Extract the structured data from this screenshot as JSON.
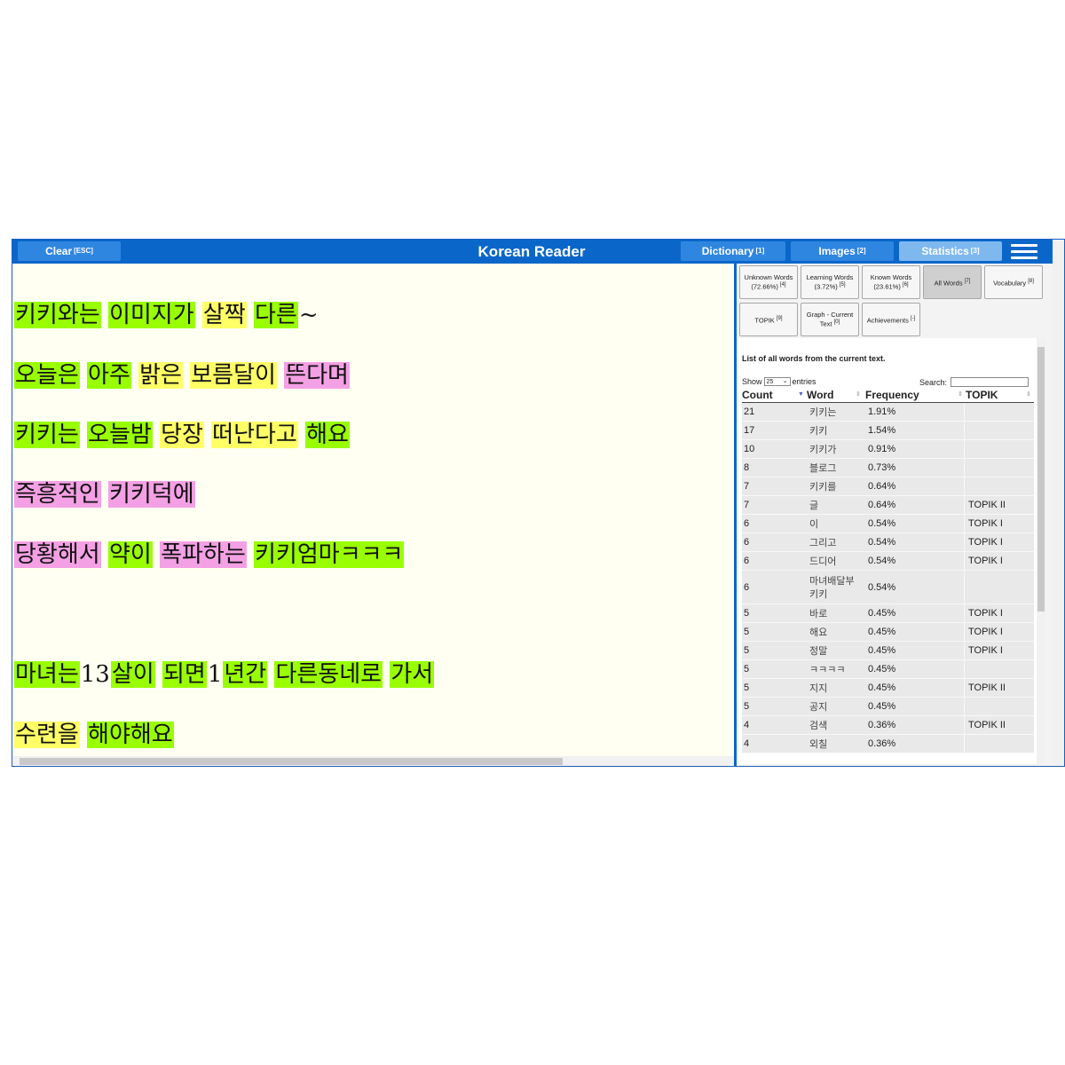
{
  "header": {
    "clear_label": "Clear",
    "clear_key": "[ESC]",
    "title": "Korean Reader",
    "dictionary_label": "Dictionary",
    "dictionary_key": "[1]",
    "images_label": "Images",
    "images_key": "[2]",
    "statistics_label": "Statistics",
    "statistics_key": "[3]",
    "menu_icon": "hamburger-menu-icon"
  },
  "colors": {
    "known": "#99ff00",
    "learning": "#ffff66",
    "unknown": "#f4a0e4",
    "header": "#0a67c9",
    "reader_bg": "#fffff2"
  },
  "reader": {
    "lines": [
      {
        "words": [
          {
            "text": "키키와는",
            "status": "g"
          },
          {
            "text": "이미지가",
            "status": "g"
          },
          {
            "text": "살짝",
            "status": "y"
          },
          {
            "text": "다른",
            "status": "g"
          },
          {
            "text": "~",
            "status": "n"
          }
        ]
      },
      {
        "words": [
          {
            "text": "오늘은",
            "status": "g"
          },
          {
            "text": "아주",
            "status": "g"
          },
          {
            "text": "밝은",
            "status": "y"
          },
          {
            "text": "보름달이",
            "status": "y"
          },
          {
            "text": "뜬다며",
            "status": "p"
          }
        ]
      },
      {
        "words": [
          {
            "text": "키키는",
            "status": "g"
          },
          {
            "text": "오늘밤",
            "status": "g"
          },
          {
            "text": "당장",
            "status": "y"
          },
          {
            "text": "떠난다고",
            "status": "y"
          },
          {
            "text": "해요",
            "status": "g"
          }
        ]
      },
      {
        "words": [
          {
            "text": "즉흥적인",
            "status": "p"
          },
          {
            "text": "키키덕에",
            "status": "p"
          }
        ]
      },
      {
        "words": [
          {
            "text": "당황해서",
            "status": "p"
          },
          {
            "text": "약이",
            "status": "g"
          },
          {
            "text": "폭파하는",
            "status": "p"
          },
          {
            "text": "키키엄마ㅋㅋㅋ",
            "status": "g"
          }
        ]
      },
      {
        "words": [
          {
            "text": "마녀는",
            "status": "g"
          },
          {
            "text": "13",
            "status": "n"
          },
          {
            "text": "살이",
            "status": "g"
          },
          {
            "text": "되면",
            "status": "g"
          },
          {
            "text": "1",
            "status": "n"
          },
          {
            "text": "년간",
            "status": "g"
          },
          {
            "text": "다른동네로",
            "status": "g"
          },
          {
            "text": "가서",
            "status": "g"
          }
        ]
      },
      {
        "words": [
          {
            "text": "수련을",
            "status": "y"
          },
          {
            "text": "해야해요",
            "status": "g"
          }
        ]
      }
    ]
  },
  "sidebar": {
    "tabs": [
      {
        "label": "Unknown Words (72.66%)",
        "key": "[4]"
      },
      {
        "label": "Learning Words (3.72%)",
        "key": "[5]"
      },
      {
        "label": "Known Words (23.61%)",
        "key": "[6]"
      },
      {
        "label": "All Words",
        "key": "[7]"
      },
      {
        "label": "Vocabulary",
        "key": "[8]"
      },
      {
        "label": "TOPIK",
        "key": "[9]"
      },
      {
        "label": "Graph - Current Text",
        "key": "[0]"
      },
      {
        "label": "Achievements",
        "key": "[-]"
      }
    ],
    "active_tab": "All Words",
    "title": "List of all words from the current text.",
    "show_label": "Show",
    "show_value": "25",
    "entries_label": "entries",
    "search_label": "Search:",
    "search_value": "",
    "columns": [
      "Count",
      "Word",
      "Frequency",
      "TOPIK"
    ],
    "rows": [
      {
        "count": "21",
        "word": "키키는",
        "freq": "1.91%",
        "topik": ""
      },
      {
        "count": "17",
        "word": "키키",
        "freq": "1.54%",
        "topik": ""
      },
      {
        "count": "10",
        "word": "키키가",
        "freq": "0.91%",
        "topik": ""
      },
      {
        "count": "8",
        "word": "블로그",
        "freq": "0.73%",
        "topik": ""
      },
      {
        "count": "7",
        "word": "키키를",
        "freq": "0.64%",
        "topik": ""
      },
      {
        "count": "7",
        "word": "글",
        "freq": "0.64%",
        "topik": "TOPIK II"
      },
      {
        "count": "6",
        "word": "이",
        "freq": "0.54%",
        "topik": "TOPIK I"
      },
      {
        "count": "6",
        "word": "그리고",
        "freq": "0.54%",
        "topik": "TOPIK I"
      },
      {
        "count": "6",
        "word": "드디어",
        "freq": "0.54%",
        "topik": "TOPIK I"
      },
      {
        "count": "6",
        "word": "마녀배달부 키키",
        "freq": "0.54%",
        "topik": ""
      },
      {
        "count": "5",
        "word": "바로",
        "freq": "0.45%",
        "topik": "TOPIK I"
      },
      {
        "count": "5",
        "word": "해요",
        "freq": "0.45%",
        "topik": "TOPIK I"
      },
      {
        "count": "5",
        "word": "정말",
        "freq": "0.45%",
        "topik": "TOPIK I"
      },
      {
        "count": "5",
        "word": "ㅋㅋㅋㅋ",
        "freq": "0.45%",
        "topik": ""
      },
      {
        "count": "5",
        "word": "지지",
        "freq": "0.45%",
        "topik": "TOPIK II"
      },
      {
        "count": "5",
        "word": "공지",
        "freq": "0.45%",
        "topik": ""
      },
      {
        "count": "4",
        "word": "검색",
        "freq": "0.36%",
        "topik": "TOPIK II"
      },
      {
        "count": "4",
        "word": "외칠",
        "freq": "0.36%",
        "topik": ""
      }
    ]
  }
}
